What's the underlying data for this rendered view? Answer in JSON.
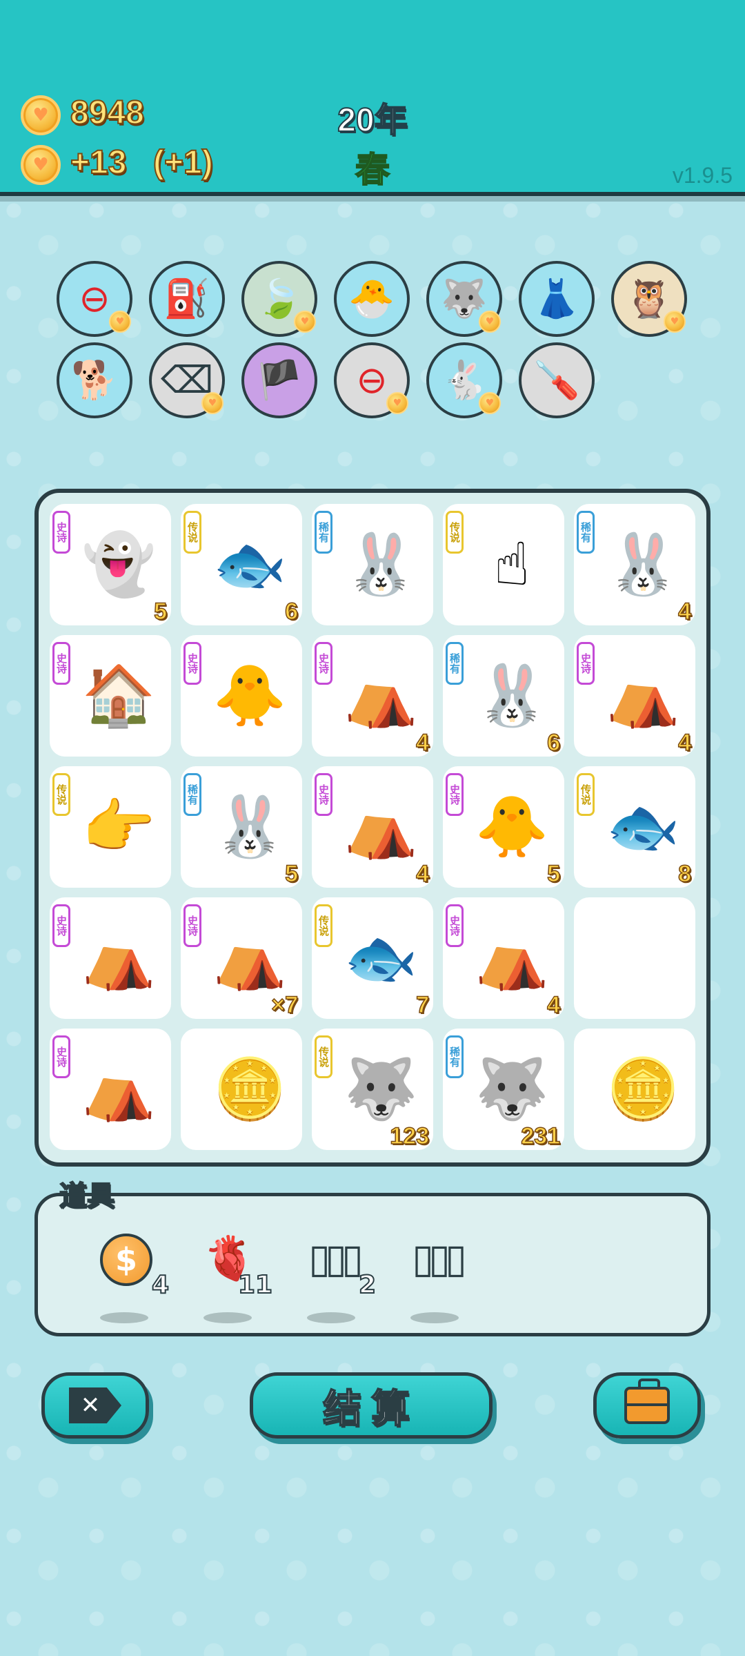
{
  "header": {
    "coins": "8948",
    "income": "+13",
    "income_bonus": "(+1)",
    "year": "20年",
    "season": "春",
    "version": "v1.9.5"
  },
  "owned_items": [
    {
      "icon": "minus-circle-icon",
      "glyph": "⊖",
      "bg": "#9fe2f0",
      "color": "#e0242a",
      "coin": true
    },
    {
      "icon": "air-pump-icon",
      "glyph": "⛽",
      "bg": "#9fe2f0",
      "color": "#e0c020",
      "coin": false
    },
    {
      "icon": "leaf-icon",
      "glyph": "🍃",
      "bg": "#c8e0cf",
      "color": "#7ac233",
      "coin": true
    },
    {
      "icon": "chick-egg-icon",
      "glyph": "🐣",
      "bg": "#9fe2f0",
      "color": "#e6a832",
      "coin": false
    },
    {
      "icon": "husky-icon",
      "glyph": "🐺",
      "bg": "#9fe2f0",
      "color": "#7a7a7a",
      "coin": true
    },
    {
      "icon": "skirt-icon",
      "glyph": "👗",
      "bg": "#9fe2f0",
      "color": "#ffffff",
      "coin": false
    },
    {
      "icon": "owl-pair-icon",
      "glyph": "🦉",
      "bg": "#efe0c0",
      "color": "#7a4a10",
      "coin": true
    },
    {
      "icon": "shiba-dog-icon",
      "glyph": "🐕",
      "bg": "#9fe2f0",
      "color": "#c07a3a",
      "coin": false
    },
    {
      "icon": "remove-tag-icon",
      "glyph": "⌫",
      "bg": "#dcdcdc",
      "color": "#2b3e44",
      "coin": true
    },
    {
      "icon": "eye-patch-icon",
      "glyph": "🏴",
      "bg": "#c9a0e6",
      "color": "#2b3e44",
      "coin": false
    },
    {
      "icon": "minus-circle-icon",
      "glyph": "⊖",
      "bg": "#dcdcdc",
      "color": "#e0242a",
      "coin": true
    },
    {
      "icon": "white-rabbit-icon",
      "glyph": "🐇",
      "bg": "#9fe2f0",
      "color": "#ffffff",
      "coin": true
    },
    {
      "icon": "screwdriver-icon",
      "glyph": "🪛",
      "bg": "#dcdcdc",
      "color": "#e6c020",
      "coin": false
    }
  ],
  "board": [
    {
      "icon": "ghost-icon",
      "glyph": "👻",
      "tag": "epic",
      "tag_label": "史诗",
      "count": "5"
    },
    {
      "icon": "koi-fish-icon",
      "glyph": "🐟",
      "tag": "legend",
      "tag_label": "传说",
      "count": "6"
    },
    {
      "icon": "rabbit-icon",
      "glyph": "🐰",
      "tag": "rare",
      "tag_label": "稀有",
      "count": ""
    },
    {
      "icon": "pointing-hand-icon",
      "glyph": "☝",
      "tag": "legend",
      "tag_label": "传说",
      "count": ""
    },
    {
      "icon": "rabbit-icon",
      "glyph": "🐰",
      "tag": "rare",
      "tag_label": "稀有",
      "count": "4"
    },
    {
      "icon": "haunted-house-icon",
      "glyph": "🏠",
      "tag": "epic",
      "tag_label": "史诗",
      "count": ""
    },
    {
      "icon": "grandpa-bird-icon",
      "glyph": "🐥",
      "tag": "epic",
      "tag_label": "史诗",
      "count": ""
    },
    {
      "icon": "rabbit-tent-icon",
      "glyph": "⛺",
      "tag": "epic",
      "tag_label": "史诗",
      "count": "4"
    },
    {
      "icon": "rabbit-icon",
      "glyph": "🐰",
      "tag": "rare",
      "tag_label": "稀有",
      "count": "6"
    },
    {
      "icon": "rabbit-tent-icon",
      "glyph": "⛺",
      "tag": "epic",
      "tag_label": "史诗",
      "count": "4"
    },
    {
      "icon": "pointing-hand-icon",
      "glyph": "👉",
      "tag": "legend",
      "tag_label": "传说",
      "count": ""
    },
    {
      "icon": "rabbit-icon",
      "glyph": "🐰",
      "tag": "rare",
      "tag_label": "稀有",
      "count": "5"
    },
    {
      "icon": "rabbit-tent-icon",
      "glyph": "⛺",
      "tag": "epic",
      "tag_label": "史诗",
      "count": "4"
    },
    {
      "icon": "grandpa-bird-icon",
      "glyph": "🐥",
      "tag": "epic",
      "tag_label": "史诗",
      "count": "5"
    },
    {
      "icon": "koi-fish-icon",
      "glyph": "🐟",
      "tag": "legend",
      "tag_label": "传说",
      "count": "8"
    },
    {
      "icon": "rabbit-tent-icon",
      "glyph": "⛺",
      "tag": "epic",
      "tag_label": "史诗",
      "count": ""
    },
    {
      "icon": "rabbit-tent-icon",
      "glyph": "⛺",
      "tag": "epic",
      "tag_label": "史诗",
      "count": "×7"
    },
    {
      "icon": "koi-fish-icon",
      "glyph": "🐟",
      "tag": "legend",
      "tag_label": "传说",
      "count": "7"
    },
    {
      "icon": "rabbit-tent-icon",
      "glyph": "⛺",
      "tag": "epic",
      "tag_label": "史诗",
      "count": "4"
    },
    {
      "icon": "",
      "glyph": "",
      "tag": "",
      "tag_label": "",
      "count": ""
    },
    {
      "icon": "rabbit-tent-icon",
      "glyph": "⛺",
      "tag": "epic",
      "tag_label": "史诗",
      "count": ""
    },
    {
      "icon": "coin-burst-icon",
      "glyph": "🪙",
      "tag": "",
      "tag_label": "",
      "count": ""
    },
    {
      "icon": "crowned-husky-icon",
      "glyph": "🐺",
      "tag": "legend",
      "tag_label": "传说",
      "count": "123"
    },
    {
      "icon": "husky-coins-icon",
      "glyph": "🐺",
      "tag": "rare",
      "tag_label": "稀有",
      "count": "231"
    },
    {
      "icon": "coin-icon",
      "glyph": "🪙",
      "tag": "",
      "tag_label": "",
      "count": ""
    }
  ],
  "props": {
    "title": "道具",
    "items": [
      {
        "icon": "dollar-coin-icon",
        "glyph": "$",
        "qty": "4"
      },
      {
        "icon": "liver-icon",
        "glyph": "🫀",
        "qty": "11"
      },
      {
        "icon": "empty-slots-icon",
        "glyph": "▯▯▯",
        "qty": "2"
      },
      {
        "icon": "rare-slots-icon",
        "glyph": "▯▯▯",
        "qty": ""
      }
    ]
  },
  "buttons": {
    "discard_glyph": "✕",
    "settle_label": "结算"
  }
}
